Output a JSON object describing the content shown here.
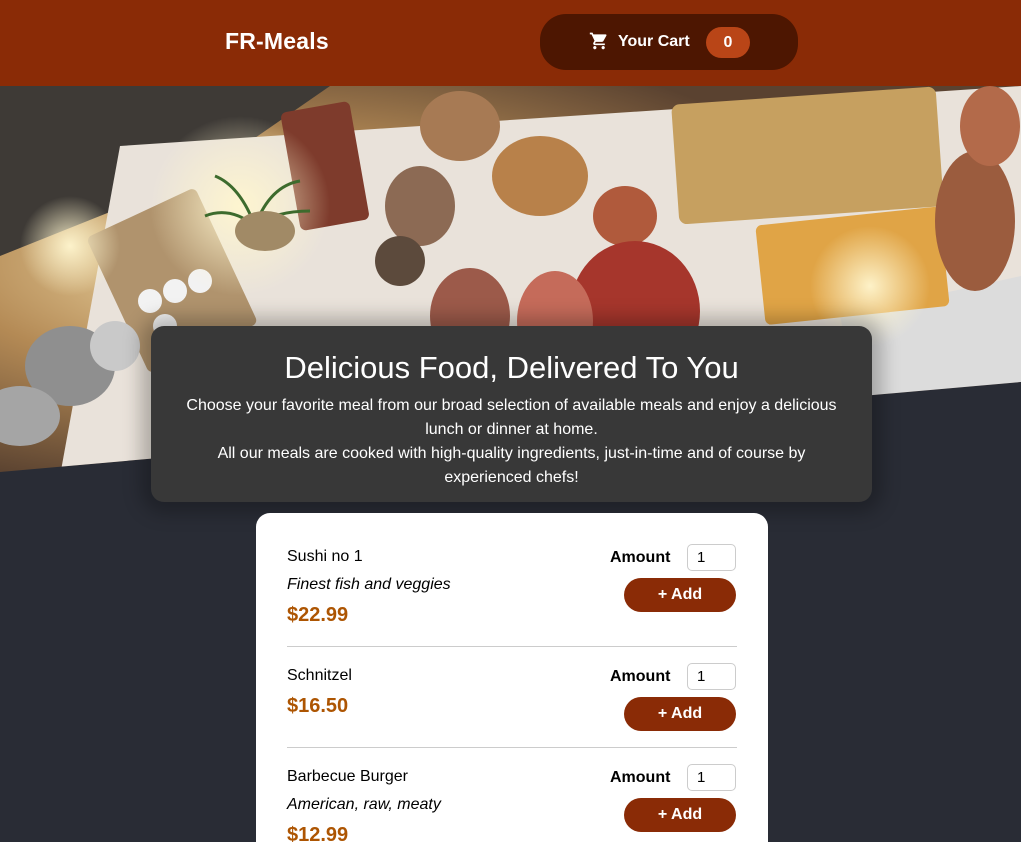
{
  "header": {
    "brand": "FR-Meals",
    "cart": {
      "label": "Your Cart",
      "count": "0",
      "icon": "cart-icon"
    }
  },
  "hero": {
    "image": "buffet-table-photo"
  },
  "summary": {
    "title": "Delicious Food, Delivered To You",
    "line1": "Choose your favorite meal from our broad selection of available meals and enjoy a delicious lunch or dinner at home.",
    "line2": "All our meals are cooked with high-quality ingredients, just-in-time and of course by experienced chefs!"
  },
  "meals": [
    {
      "name": "Sushi no 1",
      "description": "Finest fish and veggies",
      "price": "$22.99",
      "amount_label": "Amount",
      "amount": "1",
      "add_label": "+ Add"
    },
    {
      "name": "Schnitzel",
      "description": "",
      "price": "$16.50",
      "amount_label": "Amount",
      "amount": "1",
      "add_label": "+ Add"
    },
    {
      "name": "Barbecue Burger",
      "description": "American, raw, meaty",
      "price": "$12.99",
      "amount_label": "Amount",
      "amount": "1",
      "add_label": "+ Add"
    }
  ],
  "colors": {
    "header": "#8a2b06",
    "cart_button": "#4d1601",
    "badge": "#b94517",
    "price": "#ad5502",
    "page_background": "#292c35",
    "summary_background": "#383838"
  }
}
